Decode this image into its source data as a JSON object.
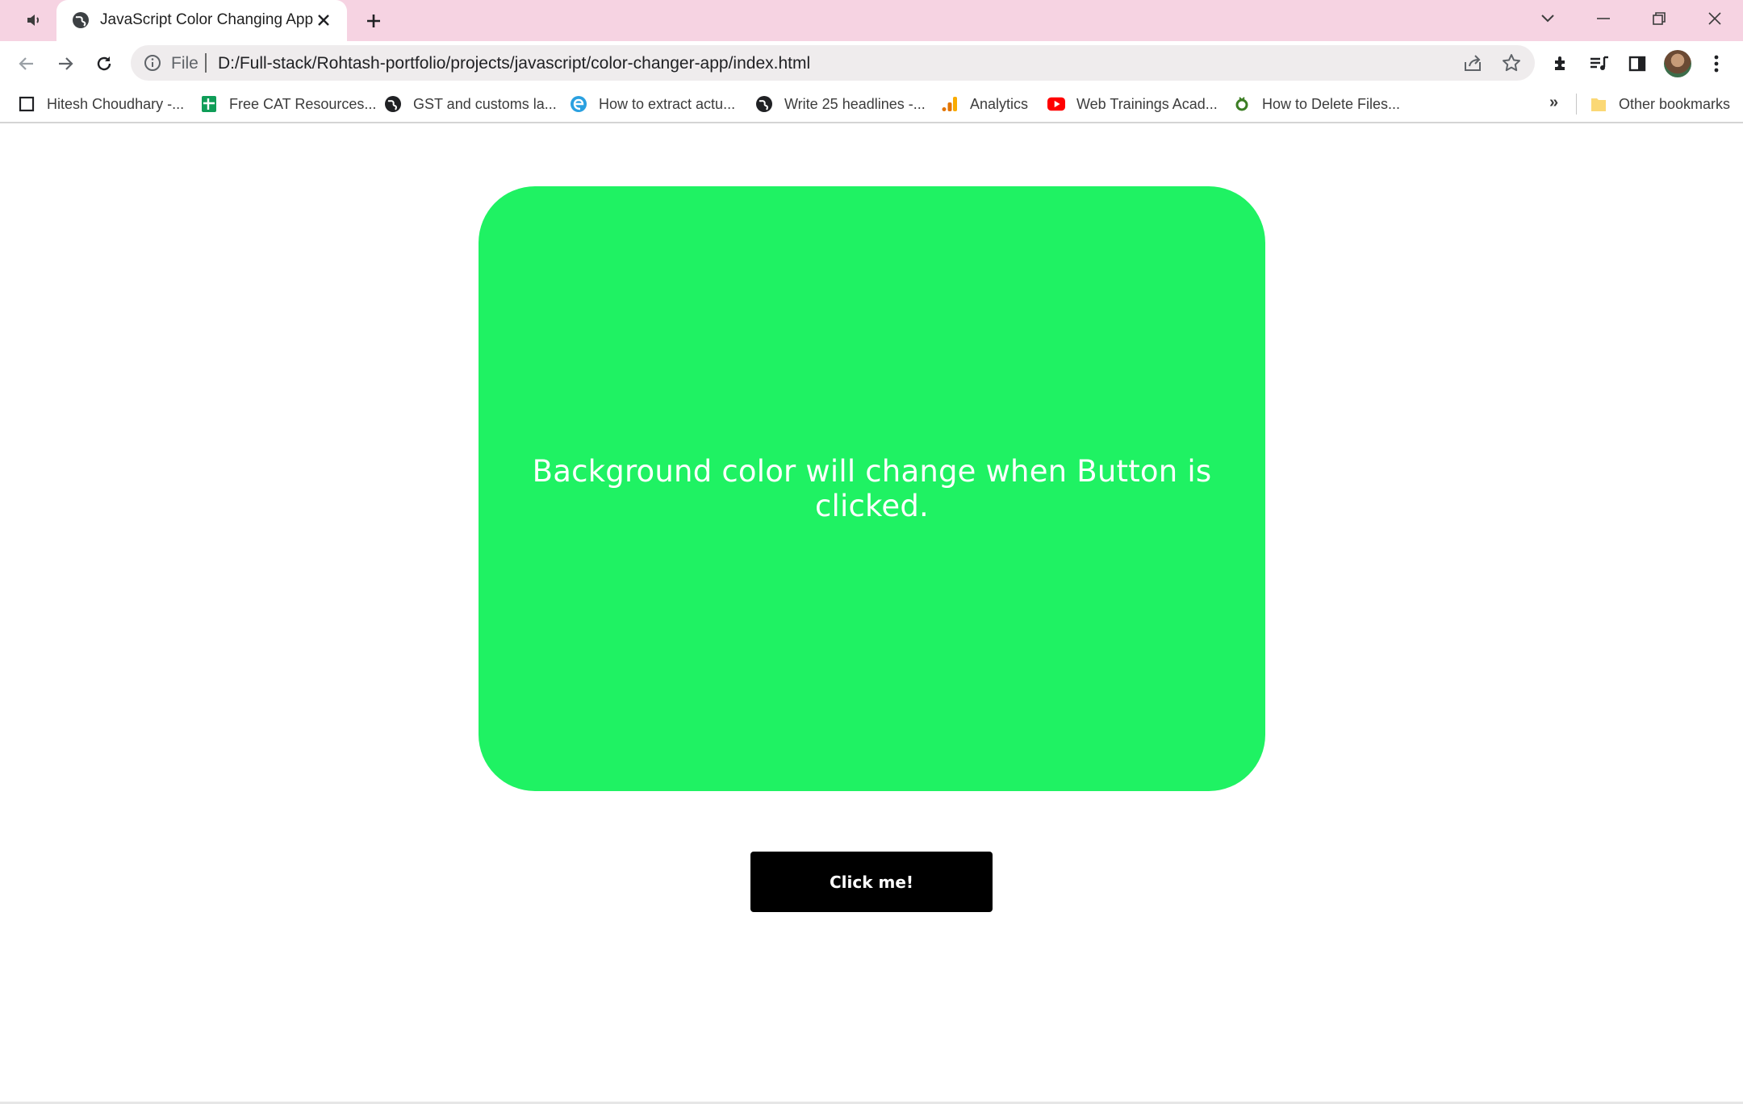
{
  "tab": {
    "title": "JavaScript Color Changing App",
    "new_tab_symbol": "+"
  },
  "address_bar": {
    "scheme_label": "File",
    "url": "D:/Full-stack/Rohtash-portfolio/projects/javascript/color-changer-app/index.html"
  },
  "bookmarks": {
    "items": [
      {
        "label": "Hitesh Choudhary -...",
        "icon": "page-outline-icon"
      },
      {
        "label": "Free CAT Resources...",
        "icon": "sheets-icon"
      },
      {
        "label": "GST and customs la...",
        "icon": "globe-icon"
      },
      {
        "label": "How to extract actu...",
        "icon": "edge-icon"
      },
      {
        "label": "Write 25 headlines -...",
        "icon": "globe-icon"
      },
      {
        "label": "Analytics",
        "icon": "analytics-icon"
      },
      {
        "label": "Web Trainings Acad...",
        "icon": "youtube-icon"
      },
      {
        "label": "How to Delete Files...",
        "icon": "site-icon"
      }
    ],
    "overflow": "»",
    "other": "Other bookmarks"
  },
  "page": {
    "card_text": "Background color will change when Button is clicked.",
    "button_label": "Click me!"
  },
  "colors": {
    "tab_strip": "#f6d3e2",
    "card_background": "#1ff263",
    "button_background": "#000000"
  }
}
